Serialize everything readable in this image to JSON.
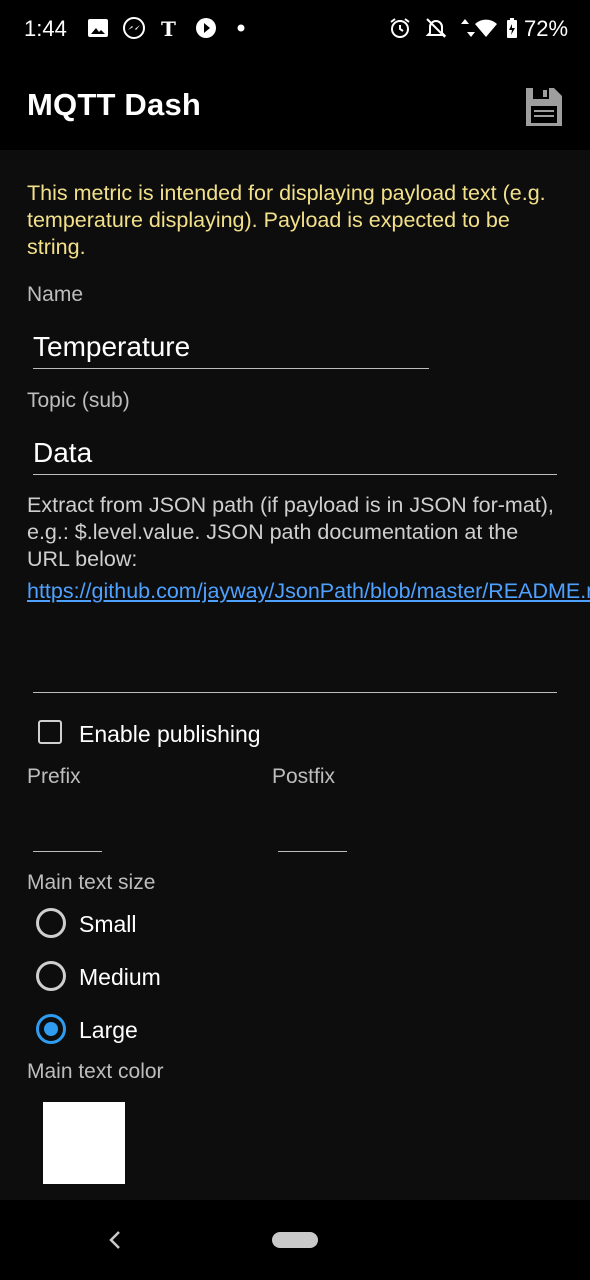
{
  "status_bar": {
    "time": "1:44",
    "battery": "72%",
    "icons": [
      "image-icon",
      "messenger-icon",
      "news-icon",
      "play-icon",
      "dot-icon",
      "alarm-icon",
      "bell-off-icon",
      "data-arrows-icon",
      "wifi-icon",
      "battery-icon"
    ]
  },
  "app_bar": {
    "title": "MQTT Dash",
    "save_icon": "save-icon"
  },
  "form": {
    "info_text": "This metric is intended for displaying payload text (e.g. temperature displaying). Payload is expected to be string.",
    "name_label": "Name",
    "name_value": "Temperature",
    "topic_label": "Topic (sub)",
    "topic_value": "Data",
    "json_helper": "Extract from JSON path (if payload is in JSON for-mat), e.g.: $.level.value. JSON path documentation at the URL below:",
    "json_link": "https://github.com/jayway/JsonPath/blob/master/README.md",
    "json_path_value": "",
    "enable_publishing_label": "Enable publishing",
    "enable_publishing_checked": false,
    "prefix_label": "Prefix",
    "prefix_value": "",
    "postfix_label": "Postfix",
    "postfix_value": "",
    "text_size_label": "Main text size",
    "text_size_options": [
      "Small",
      "Medium",
      "Large"
    ],
    "text_size_selected": "Large",
    "text_color_label": "Main text color",
    "text_color_value": "#ffffff"
  },
  "colors": {
    "accent": "#2f9cf0",
    "info_text": "#f2e08a",
    "link": "#4ea1ff"
  }
}
